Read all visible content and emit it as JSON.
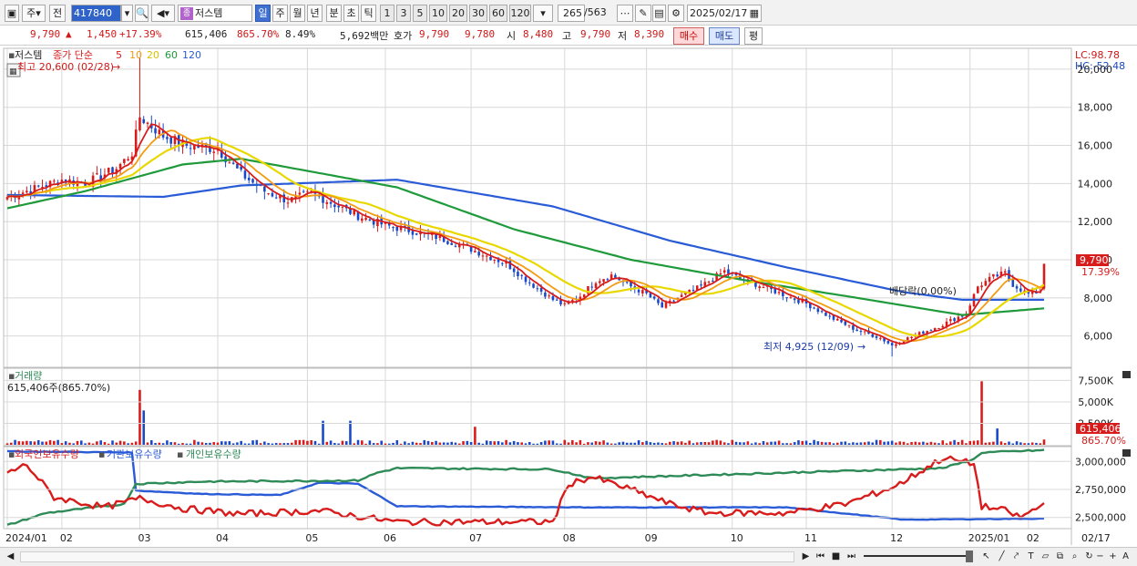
{
  "toolbar": {
    "market_label": "주",
    "prev_label": "전",
    "stock_code": "417840",
    "stock_name": "저스템",
    "name_badge": "종",
    "periods": [
      "일",
      "주",
      "월",
      "년",
      "분",
      "초",
      "틱"
    ],
    "selected_period": "일",
    "intervals": [
      "1",
      "3",
      "5",
      "10",
      "20",
      "30",
      "60",
      "120"
    ],
    "count_value": "265",
    "count_total": "/563",
    "date": "2025/02/17"
  },
  "info": {
    "price": "9,790",
    "change": "1,450",
    "change_pct": "+17.39%",
    "volume": "615,406",
    "volume_ratio": "865.70%",
    "turnover": "8.49%",
    "amount": "5,692백만",
    "ask_label": "호가",
    "ask": "9,790",
    "bid": "9,780",
    "open_label": "시",
    "open": "8,480",
    "high_label": "고",
    "high": "9,790",
    "low_label": "저",
    "low": "8,390",
    "buy_label": "매수",
    "sell_label": "매도",
    "flat_label": "평"
  },
  "legend": {
    "stock": "저스템",
    "close_simple": "종가 단순",
    "ma_labels": [
      "5",
      "10",
      "20",
      "60",
      "120"
    ],
    "ma_colors": [
      "#d81c1c",
      "#f39c12",
      "#e8d800",
      "#1f9a3a",
      "#2a5bd7"
    ]
  },
  "axis_right": {
    "price_ticks": [
      "20,000",
      "18,000",
      "16,000",
      "14,000",
      "12,000",
      "10,000",
      "8,000",
      "6,000"
    ],
    "lc": "LC:98.78",
    "hc": "HC:-52.48",
    "current_price": "9,790",
    "current_pct": "17.39%",
    "volume_ticks": [
      "7,500K",
      "5,000K",
      "2,500K"
    ],
    "volume_current": "615,406",
    "volume_pct": "865.70%",
    "holding_ticks": [
      "3,000,000",
      "2,750,000",
      "2,500,000"
    ]
  },
  "annotations": {
    "high": "최고 20,600 (02/28)",
    "low": "최저 4,925 (12/09)",
    "dividend": "배당락(0.00%)"
  },
  "volume_panel": {
    "title": "거래량",
    "current": "615,406주(865.70%)"
  },
  "holding_panel": {
    "series": [
      "외국인보유수량",
      "기관보유수량",
      "개인보유수량"
    ],
    "colors": [
      "#d81c1c",
      "#2a5bd7",
      "#2e8b57"
    ]
  },
  "x_axis": {
    "labels": [
      "2024/01",
      "02",
      "03",
      "04",
      "05",
      "06",
      "07",
      "08",
      "09",
      "10",
      "11",
      "12",
      "2025/01",
      "02"
    ],
    "last_date": "02/17"
  },
  "colors": {
    "up": "#d81c1c",
    "down": "#1a48c8",
    "grid": "#d8d8d8"
  },
  "chart_data": {
    "type": "candlestick",
    "ylim": [
      4500,
      21000
    ],
    "volume_ylim": [
      0,
      8500000
    ],
    "holding_ylim": [
      2400000,
      3100000
    ],
    "month_start_index": [
      0,
      14,
      34,
      54,
      77,
      97,
      119,
      143,
      164,
      186,
      205,
      227,
      247,
      262
    ],
    "anchors_close": [
      [
        0,
        13300
      ],
      [
        8,
        13800
      ],
      [
        14,
        14200
      ],
      [
        20,
        14000
      ],
      [
        28,
        14800
      ],
      [
        32,
        15600
      ],
      [
        34,
        17500
      ],
      [
        40,
        16500
      ],
      [
        46,
        16000
      ],
      [
        54,
        15800
      ],
      [
        60,
        14500
      ],
      [
        66,
        13600
      ],
      [
        72,
        13100
      ],
      [
        78,
        13500
      ],
      [
        84,
        12900
      ],
      [
        90,
        12300
      ],
      [
        97,
        11800
      ],
      [
        104,
        11500
      ],
      [
        110,
        11200
      ],
      [
        116,
        10800
      ],
      [
        122,
        10300
      ],
      [
        128,
        9800
      ],
      [
        134,
        8800
      ],
      [
        140,
        7900
      ],
      [
        143,
        7600
      ],
      [
        147,
        8100
      ],
      [
        151,
        8900
      ],
      [
        155,
        9200
      ],
      [
        160,
        8600
      ],
      [
        164,
        8200
      ],
      [
        168,
        7500
      ],
      [
        172,
        8000
      ],
      [
        178,
        8600
      ],
      [
        184,
        9400
      ],
      [
        188,
        9000
      ],
      [
        195,
        8500
      ],
      [
        200,
        8100
      ],
      [
        205,
        7700
      ],
      [
        211,
        7000
      ],
      [
        218,
        6300
      ],
      [
        224,
        5900
      ],
      [
        227,
        5500
      ],
      [
        230,
        5800
      ],
      [
        235,
        6200
      ],
      [
        240,
        6600
      ],
      [
        244,
        7000
      ],
      [
        246,
        7200
      ],
      [
        249,
        8600
      ],
      [
        253,
        9100
      ],
      [
        256,
        9300
      ],
      [
        258,
        8700
      ],
      [
        262,
        8200
      ],
      [
        265,
        8340
      ],
      [
        266,
        9790
      ]
    ],
    "anchors_sma60": [
      [
        0,
        12700
      ],
      [
        20,
        13600
      ],
      [
        45,
        15000
      ],
      [
        60,
        15300
      ],
      [
        100,
        13800
      ],
      [
        130,
        11600
      ],
      [
        160,
        10000
      ],
      [
        190,
        8900
      ],
      [
        215,
        8100
      ],
      [
        245,
        7100
      ],
      [
        266,
        7450
      ]
    ],
    "anchors_sma120": [
      [
        0,
        13400
      ],
      [
        40,
        13300
      ],
      [
        60,
        13900
      ],
      [
        100,
        14200
      ],
      [
        140,
        12800
      ],
      [
        170,
        11000
      ],
      [
        200,
        9600
      ],
      [
        230,
        8300
      ],
      [
        245,
        7900
      ],
      [
        266,
        7900
      ]
    ],
    "volume_spikes": {
      "34": 6400000,
      "35": 4000000,
      "81": 2800000,
      "88": 2800000,
      "120": 2100000,
      "250": 7400000,
      "254": 1900000,
      "266": 615406
    },
    "holding_foreign": [
      [
        0,
        2900000
      ],
      [
        5,
        2970000
      ],
      [
        12,
        2680000
      ],
      [
        25,
        2590000
      ],
      [
        34,
        2670000
      ],
      [
        45,
        2580000
      ],
      [
        60,
        2530000
      ],
      [
        80,
        2560000
      ],
      [
        100,
        2460000
      ],
      [
        140,
        2460000
      ],
      [
        144,
        2800000
      ],
      [
        150,
        2860000
      ],
      [
        160,
        2750000
      ],
      [
        170,
        2620000
      ],
      [
        180,
        2540000
      ],
      [
        200,
        2540000
      ],
      [
        215,
        2620000
      ],
      [
        228,
        2780000
      ],
      [
        240,
        3030000
      ],
      [
        248,
        2980000
      ],
      [
        250,
        2600000
      ],
      [
        256,
        2560000
      ],
      [
        260,
        2500000
      ],
      [
        266,
        2620000
      ]
    ],
    "holding_institution": [
      [
        0,
        3090000
      ],
      [
        32,
        3080000
      ],
      [
        33,
        2740000
      ],
      [
        50,
        2710000
      ],
      [
        70,
        2700000
      ],
      [
        80,
        2810000
      ],
      [
        90,
        2800000
      ],
      [
        100,
        2600000
      ],
      [
        150,
        2590000
      ],
      [
        200,
        2590000
      ],
      [
        230,
        2480000
      ],
      [
        266,
        2490000
      ]
    ],
    "holding_individual": [
      [
        0,
        2430000
      ],
      [
        10,
        2540000
      ],
      [
        30,
        2620000
      ],
      [
        33,
        2800000
      ],
      [
        50,
        2820000
      ],
      [
        90,
        2830000
      ],
      [
        95,
        2900000
      ],
      [
        100,
        2940000
      ],
      [
        140,
        2930000
      ],
      [
        150,
        2850000
      ],
      [
        200,
        2900000
      ],
      [
        240,
        2940000
      ],
      [
        248,
        3020000
      ],
      [
        250,
        3080000
      ],
      [
        266,
        3100000
      ]
    ]
  }
}
